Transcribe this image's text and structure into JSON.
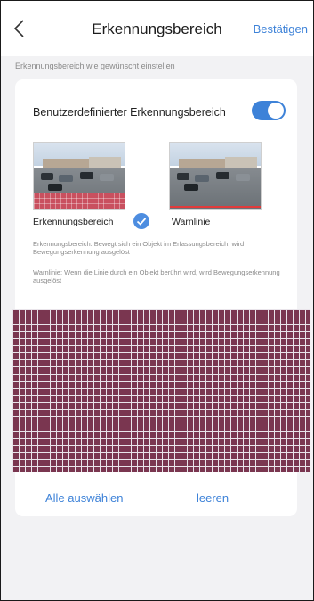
{
  "header": {
    "title": "Erkennungsbereich",
    "confirm_label": "Bestätigen",
    "back_icon": "chevron-left-icon"
  },
  "subtitle": "Erkennungsbereich wie gewünscht einstellen",
  "card": {
    "toggle": {
      "label": "Benutzerdefinierter Erkennungsbereich",
      "state": "on",
      "accent_color": "#3d82d8"
    },
    "modes": [
      {
        "label": "Erkennungsbereich",
        "selected": true,
        "icon": "checkmark-icon"
      },
      {
        "label": "Warnlinie",
        "selected": false
      }
    ],
    "descriptions": [
      "Erkennungsbereich: Bewegt sich ein Objekt im Erfassungsbereich, wird Bewegungserkennung ausgelöst",
      "Warnlinie: Wenn die Linie durch ein Objekt berührt wird, wird Bewegungserkennung ausgelöst"
    ],
    "grid": {
      "cell_color": "#7a3650",
      "line_color": "#e9e4ea"
    },
    "actions": {
      "select_all": "Alle auswählen",
      "clear": "leeren"
    }
  }
}
